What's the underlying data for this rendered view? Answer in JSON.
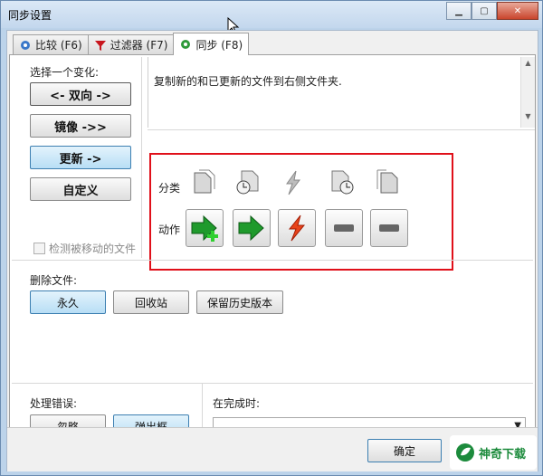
{
  "window": {
    "title": "同步设置",
    "min": "▁",
    "max": "▢",
    "close": "✕"
  },
  "tabs": [
    {
      "label": "比较 (F6)",
      "icon": "gear-blue-icon"
    },
    {
      "label": "过滤器 (F7)",
      "icon": "filter-funnel-icon"
    },
    {
      "label": "同步 (F8)",
      "icon": "gear-green-icon",
      "active": true
    }
  ],
  "sync": {
    "choose_label": "选择一个变化:",
    "variants": [
      {
        "label": "<- 双向 ->",
        "selected": false
      },
      {
        "label": "镜像 ->>",
        "selected": false
      },
      {
        "label": "更新 ->",
        "selected": true
      },
      {
        "label": "自定义",
        "selected": false
      }
    ],
    "detect_moved": "检测被移动的文件",
    "description": "复制新的和已更新的文件到右侧文件夹.",
    "category_label": "分类",
    "action_label": "动作"
  },
  "delete": {
    "label": "删除文件:",
    "options": [
      {
        "label": "永久",
        "selected": true
      },
      {
        "label": "回收站",
        "selected": false
      },
      {
        "label": "保留历史版本",
        "selected": false
      }
    ]
  },
  "errors": {
    "label": "处理错误:",
    "options": [
      {
        "label": "忽略",
        "selected": false
      },
      {
        "label": "弹出框",
        "selected": true
      }
    ]
  },
  "on_complete": {
    "label": "在完成时:",
    "value": ""
  },
  "footer": {
    "ok": "确定"
  },
  "watermark": {
    "text": "神奇下载"
  },
  "colors": {
    "accent": "#3c7fb1",
    "highlight": "#e0101a",
    "green": "#1c8b3c"
  }
}
